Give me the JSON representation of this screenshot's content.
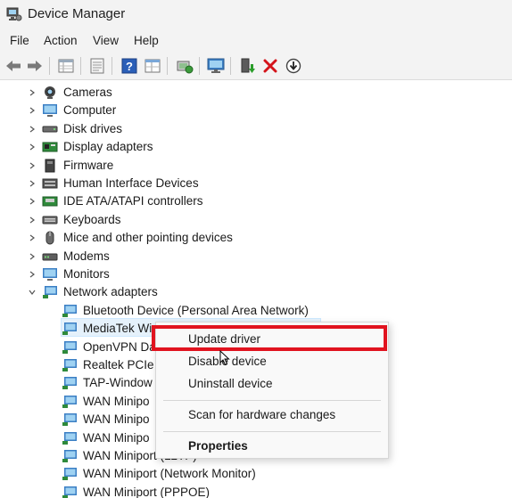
{
  "window": {
    "title": "Device Manager",
    "icon": "device-manager-icon"
  },
  "menu": [
    "File",
    "Action",
    "View",
    "Help"
  ],
  "toolbar": {
    "buttons": [
      "back-icon",
      "forward-icon",
      "properties-grid-icon",
      "show-hidden-icon",
      "help-icon",
      "view-icon",
      "update-driver-icon",
      "monitor-icon",
      "enable-device-icon",
      "uninstall-icon",
      "scan-icon"
    ]
  },
  "tree": {
    "categories": [
      {
        "label": "Cameras",
        "icon": "camera-icon",
        "expanded": false
      },
      {
        "label": "Computer",
        "icon": "computer-icon",
        "expanded": false
      },
      {
        "label": "Disk drives",
        "icon": "disk-drive-icon",
        "expanded": false
      },
      {
        "label": "Display adapters",
        "icon": "display-adapter-icon",
        "expanded": false
      },
      {
        "label": "Firmware",
        "icon": "firmware-icon",
        "expanded": false
      },
      {
        "label": "Human Interface Devices",
        "icon": "hid-icon",
        "expanded": false
      },
      {
        "label": "IDE ATA/ATAPI controllers",
        "icon": "ide-controller-icon",
        "expanded": false
      },
      {
        "label": "Keyboards",
        "icon": "keyboard-icon",
        "expanded": false
      },
      {
        "label": "Mice and other pointing devices",
        "icon": "mouse-icon",
        "expanded": false
      },
      {
        "label": "Modems",
        "icon": "modem-icon",
        "expanded": false
      },
      {
        "label": "Monitors",
        "icon": "monitor-icon",
        "expanded": false
      },
      {
        "label": "Network adapters",
        "icon": "network-adapter-icon",
        "expanded": true
      }
    ],
    "network_adapters": [
      "Bluetooth Device (Personal Area Network)",
      "MediaTek Wi",
      "OpenVPN Da",
      "Realtek PCIe",
      "TAP-Window",
      "WAN Minipo",
      "WAN Minipo",
      "WAN Minipo",
      "WAN Miniport (L2TP)",
      "WAN Miniport (Network Monitor)",
      "WAN Miniport (PPPOE)"
    ],
    "selected": "MediaTek Wi"
  },
  "context_menu": {
    "items": [
      "Update driver",
      "Disable device",
      "Uninstall device",
      "Scan for hardware changes",
      "Properties"
    ],
    "highlighted": "Update driver",
    "highlight_color": "#e1131f"
  },
  "colors": {
    "selection": "#e5f1fb",
    "chrome": "#f3f3f3",
    "accent_red": "#e1131f"
  }
}
